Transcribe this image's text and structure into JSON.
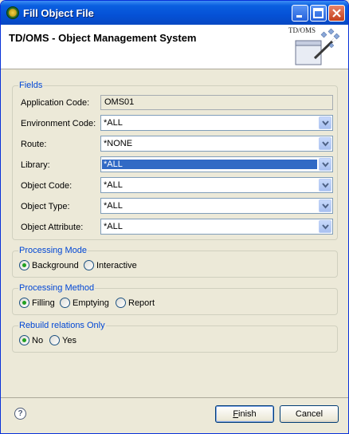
{
  "window": {
    "title": "Fill Object File"
  },
  "header": {
    "title": "TD/OMS - Object Management System",
    "logo_text": "TD/OMS"
  },
  "fields_group": {
    "legend": "Fields",
    "application_code": {
      "label": "Application Code:",
      "value": "OMS01"
    },
    "environment_code": {
      "label": "Environment Code:",
      "value": "*ALL"
    },
    "route": {
      "label": "Route:",
      "value": "*NONE"
    },
    "library": {
      "label": "Library:",
      "value": "*ALL"
    },
    "object_code": {
      "label": "Object Code:",
      "value": "*ALL"
    },
    "object_type": {
      "label": "Object Type:",
      "value": "*ALL"
    },
    "object_attribute": {
      "label": "Object Attribute:",
      "value": "*ALL"
    }
  },
  "processing_mode": {
    "legend": "Processing Mode",
    "options": [
      "Background",
      "Interactive"
    ],
    "selected": "Background"
  },
  "processing_method": {
    "legend": "Processing Method",
    "options": [
      "Filling",
      "Emptying",
      "Report"
    ],
    "selected": "Filling"
  },
  "rebuild_relations": {
    "legend": "Rebuild relations Only",
    "options": [
      "No",
      "Yes"
    ],
    "selected": "No"
  },
  "footer": {
    "help_glyph": "?",
    "finish_label_mnemonic": "F",
    "finish_label_rest": "inish",
    "cancel_label": "Cancel"
  },
  "colors": {
    "titlebar": "#0551d6",
    "legend": "#0046d5",
    "selection": "#316ac5",
    "radio_dot": "#21a121"
  }
}
